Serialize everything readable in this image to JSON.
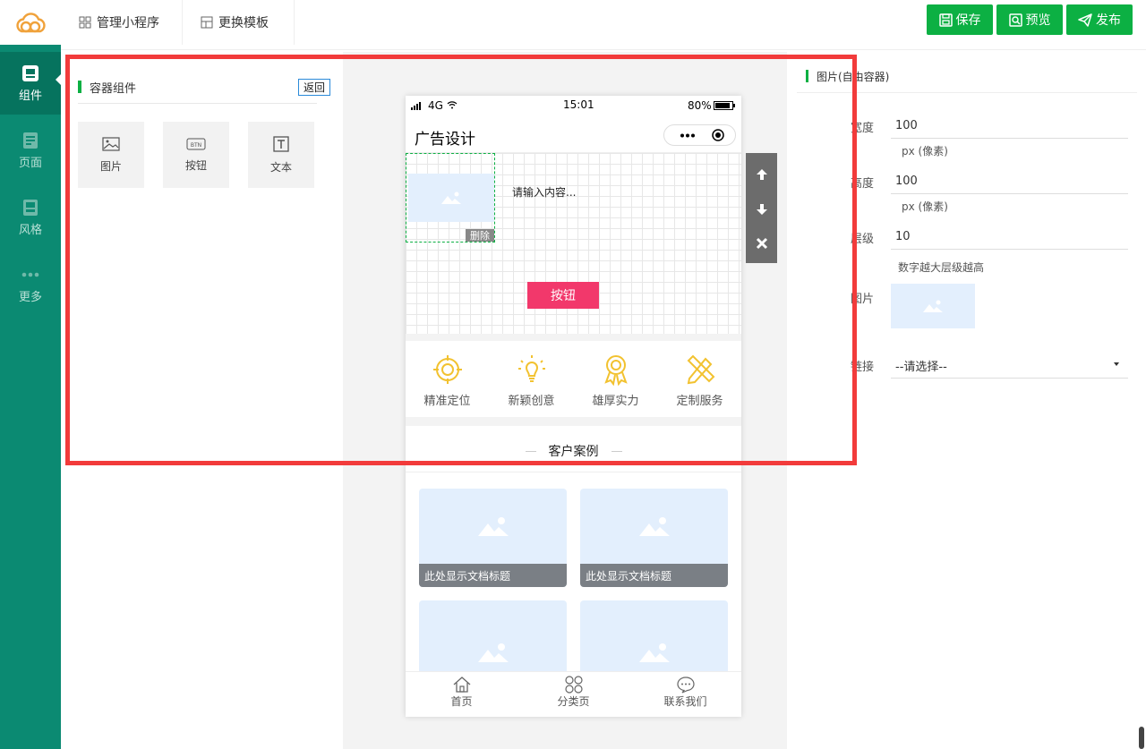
{
  "rail": {
    "items": [
      {
        "label": "组件",
        "icon": "component-icon",
        "active": true
      },
      {
        "label": "页面",
        "icon": "page-icon",
        "active": false
      },
      {
        "label": "风格",
        "icon": "style-icon",
        "active": false
      },
      {
        "label": "更多",
        "icon": "more-icon",
        "active": false
      }
    ]
  },
  "topbar": {
    "tabs": [
      "管理小程序",
      "更换模板"
    ],
    "save_label": "保存",
    "preview_label": "预览",
    "publish_label": "发布",
    "accent": "#0cb043"
  },
  "components_panel": {
    "title": "容器组件",
    "back_label": "返回",
    "tiles": [
      {
        "label": "图片",
        "icon": "image-icon"
      },
      {
        "label": "按钮",
        "icon": "btn-icon"
      },
      {
        "label": "文本",
        "icon": "text-icon"
      }
    ]
  },
  "phone": {
    "status": {
      "signal": "4G",
      "time": "15:01",
      "battery": "80%"
    },
    "title": "广告设计",
    "canvas": {
      "delete_label": "删除",
      "input_text": "请输入内容...",
      "button_label": "按钮",
      "button_color": "#f2386b"
    },
    "features": [
      "精准定位",
      "新颖创意",
      "雄厚实力",
      "定制服务"
    ],
    "case_title": "客户案例",
    "cards": [
      "此处显示文档标题",
      "此处显示文档标题",
      "",
      ""
    ],
    "tabbar": [
      "首页",
      "分类页",
      "联系我们"
    ]
  },
  "properties": {
    "title": "图片(自由容器)",
    "width_label": "宽度",
    "width_value": "100",
    "width_unit": "px (像素)",
    "height_label": "高度",
    "height_value": "100",
    "height_unit": "px (像素)",
    "layer_label": "层级",
    "layer_value": "10",
    "layer_hint": "数字越大层级越高",
    "image_label": "图片",
    "link_label": "链接",
    "link_value": "--请选择--"
  }
}
